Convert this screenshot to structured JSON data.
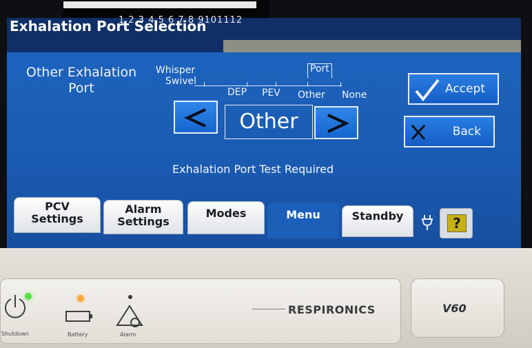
{
  "header": {
    "scale_numbers": "1 2 3 4 5 6 7 8 9101112",
    "title": "Exhalation Port Selection"
  },
  "parameter": {
    "label_line1": "Other Exhalation",
    "label_line2": "Port"
  },
  "selector": {
    "options": [
      {
        "line1": "Whisper",
        "line2": "Swivel"
      },
      {
        "label": "DEP"
      },
      {
        "label": "PEV"
      },
      {
        "label": "Other",
        "marker": "Port"
      },
      {
        "label": "None"
      }
    ],
    "current_value": "Other"
  },
  "status": "Exhalation Port Test Required",
  "actions": {
    "accept_label": "Accept",
    "back_label": "Back"
  },
  "tabs": [
    {
      "line1": "PCV",
      "line2": "Settings"
    },
    {
      "line1": "Alarm",
      "line2": "Settings"
    },
    {
      "label": "Modes"
    },
    {
      "label": "Menu",
      "active": true
    },
    {
      "label": "Standby"
    }
  ],
  "help_label": "?",
  "icons": {
    "left": "chevron-left-icon",
    "right": "chevron-right-icon",
    "accept": "checkmark-icon",
    "back": "x-icon",
    "plug": "power-plug-icon"
  },
  "hardware": {
    "brand": "RESPIRONICS",
    "model": "V60",
    "shutdown_label": "Shutdown",
    "battery_label": "Battery",
    "alarm_label": "Alarm"
  },
  "colors": {
    "screen_blue": "#1b5fb8",
    "title_bar": "#0f2f66",
    "button_blue": "#2a7ee3",
    "help_yellow": "#c8b017",
    "led_green": "#58e048",
    "led_amber": "#f7a93a"
  }
}
